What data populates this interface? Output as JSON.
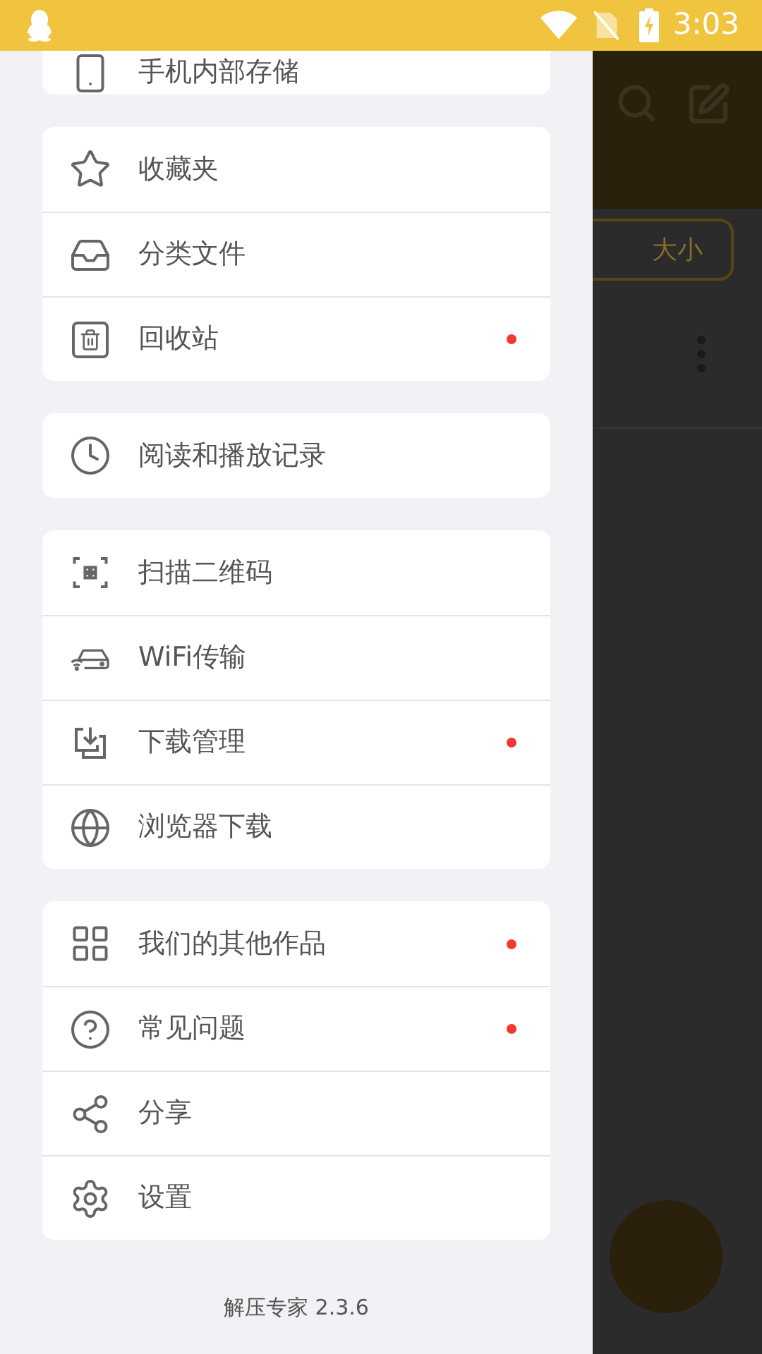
{
  "status_bar": {
    "time": "3:03"
  },
  "drawer": {
    "groups": [
      {
        "items": [
          {
            "label": "手机内部存储",
            "dot": false
          }
        ]
      },
      {
        "items": [
          {
            "label": "收藏夹",
            "dot": false
          },
          {
            "label": "分类文件",
            "dot": false
          },
          {
            "label": "回收站",
            "dot": true
          }
        ]
      },
      {
        "items": [
          {
            "label": "阅读和播放记录",
            "dot": false
          }
        ]
      },
      {
        "items": [
          {
            "label": "扫描二维码",
            "dot": false
          },
          {
            "label": "WiFi传输",
            "dot": false
          },
          {
            "label": "下载管理",
            "dot": true
          },
          {
            "label": "浏览器下载",
            "dot": false
          }
        ]
      },
      {
        "items": [
          {
            "label": "我们的其他作品",
            "dot": true
          },
          {
            "label": "常见问题",
            "dot": true
          },
          {
            "label": "分享",
            "dot": false
          },
          {
            "label": "设置",
            "dot": false
          }
        ]
      }
    ],
    "version": "解压专家 2.3.6"
  },
  "background": {
    "sort_button": "大小"
  }
}
